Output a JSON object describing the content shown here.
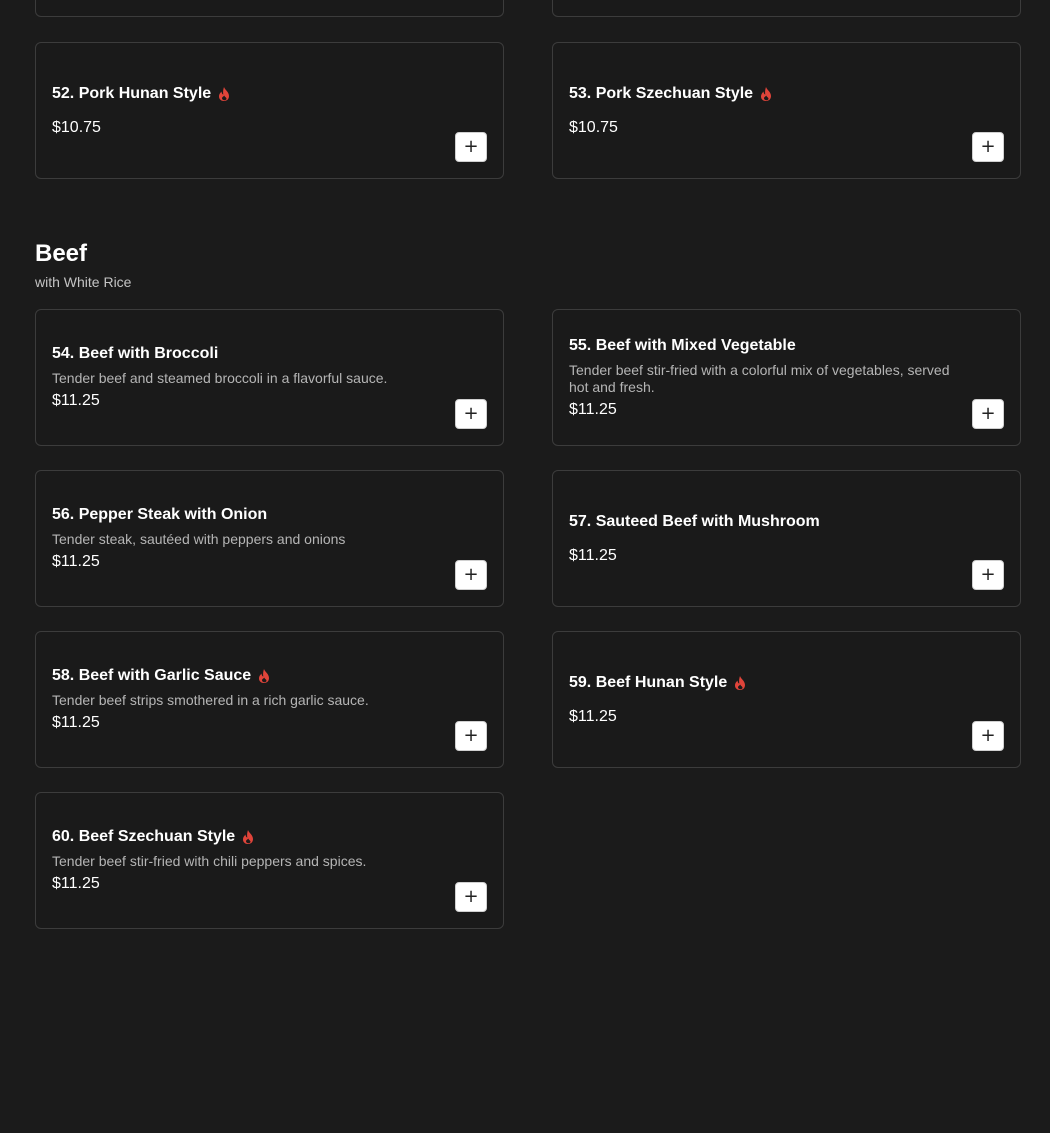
{
  "section": {
    "title": "Beef",
    "subtitle": "with White Rice"
  },
  "icons": {
    "spicy": "fire-icon",
    "add": "plus-icon",
    "spicy_color": "#e0443a"
  },
  "pork_items": [
    {
      "name": "52. Pork Hunan Style",
      "price": "$10.75",
      "spicy": true,
      "add_symbol": "+"
    },
    {
      "name": "53. Pork Szechuan Style",
      "price": "$10.75",
      "spicy": true,
      "add_symbol": "+"
    }
  ],
  "beef_items": [
    {
      "name": "54. Beef with Broccoli",
      "description": "Tender beef and steamed broccoli in a flavorful sauce.",
      "price": "$11.25",
      "spicy": false,
      "add_symbol": "+"
    },
    {
      "name": "55. Beef with Mixed Vegetable",
      "description": "Tender beef stir-fried with a colorful mix of vegetables, served hot and fresh.",
      "price": "$11.25",
      "spicy": false,
      "add_symbol": "+"
    },
    {
      "name": "56. Pepper Steak with Onion",
      "description": "Tender steak, sautéed with peppers and onions",
      "price": "$11.25",
      "spicy": false,
      "add_symbol": "+"
    },
    {
      "name": "57. Sauteed Beef with Mushroom",
      "price": "$11.25",
      "spicy": false,
      "add_symbol": "+"
    },
    {
      "name": "58. Beef with Garlic Sauce",
      "description": "Tender beef strips smothered in a rich garlic sauce.",
      "price": "$11.25",
      "spicy": true,
      "add_symbol": "+"
    },
    {
      "name": "59. Beef Hunan Style",
      "price": "$11.25",
      "spicy": true,
      "add_symbol": "+"
    },
    {
      "name": "60. Beef Szechuan Style",
      "description": "Tender beef stir-fried with chili peppers and spices.",
      "price": "$11.25",
      "spicy": true,
      "add_symbol": "+"
    }
  ]
}
